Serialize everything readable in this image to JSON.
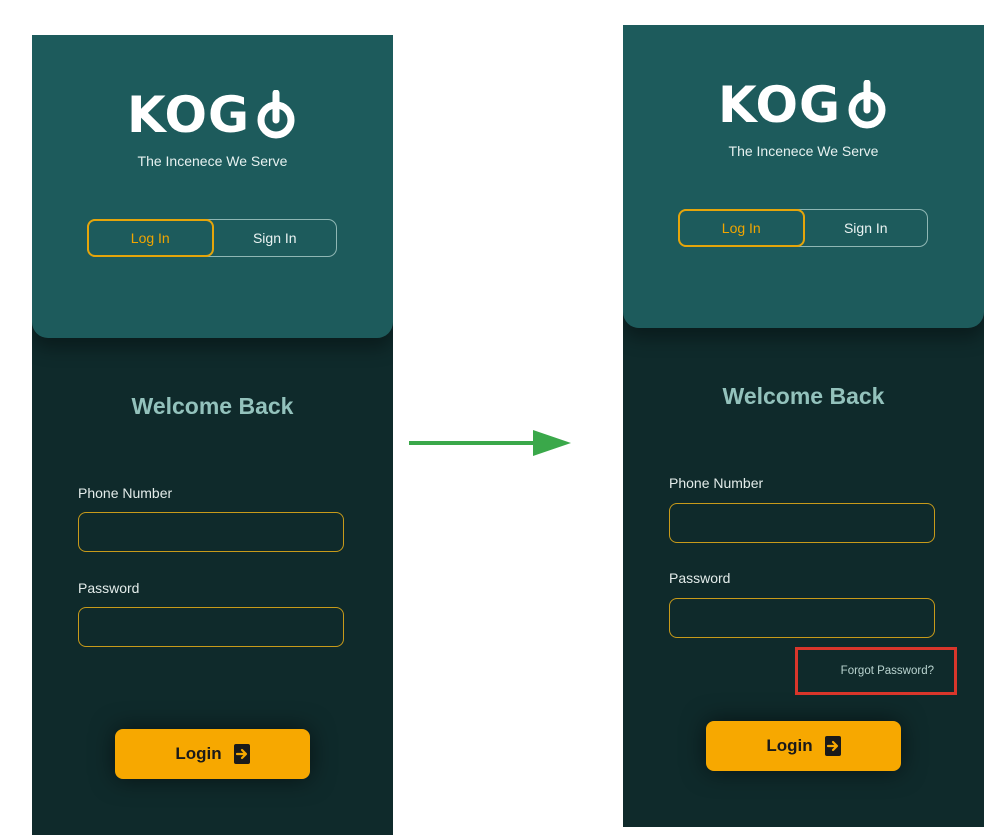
{
  "colors": {
    "header_bg": "#1d5b5c",
    "body_bg": "#0f2a2b",
    "accent": "#f7a800",
    "welcome_text": "#93c2bc",
    "arrow": "#3aa84a",
    "highlight_box": "#d9362b"
  },
  "arrow_icon": "right-arrow-icon",
  "screens": [
    {
      "logo": {
        "text": "KOG",
        "icon": "power-icon"
      },
      "tagline": "The Incenece We Serve",
      "tabs": [
        {
          "label": "Log In",
          "active": true
        },
        {
          "label": "Sign In",
          "active": false
        }
      ],
      "welcome": "Welcome Back",
      "phone": {
        "label": "Phone Number",
        "value": ""
      },
      "password": {
        "label": "Password",
        "value": ""
      },
      "login_button": {
        "label": "Login",
        "icon": "login-arrow-icon"
      }
    },
    {
      "logo": {
        "text": "KOG",
        "icon": "power-icon"
      },
      "tagline": "The Incenece We Serve",
      "tabs": [
        {
          "label": "Log In",
          "active": true
        },
        {
          "label": "Sign In",
          "active": false
        }
      ],
      "welcome": "Welcome Back",
      "phone": {
        "label": "Phone Number",
        "value": ""
      },
      "password": {
        "label": "Password",
        "value": ""
      },
      "forgot_password": "Forgot Password?",
      "login_button": {
        "label": "Login",
        "icon": "login-arrow-icon"
      }
    }
  ]
}
